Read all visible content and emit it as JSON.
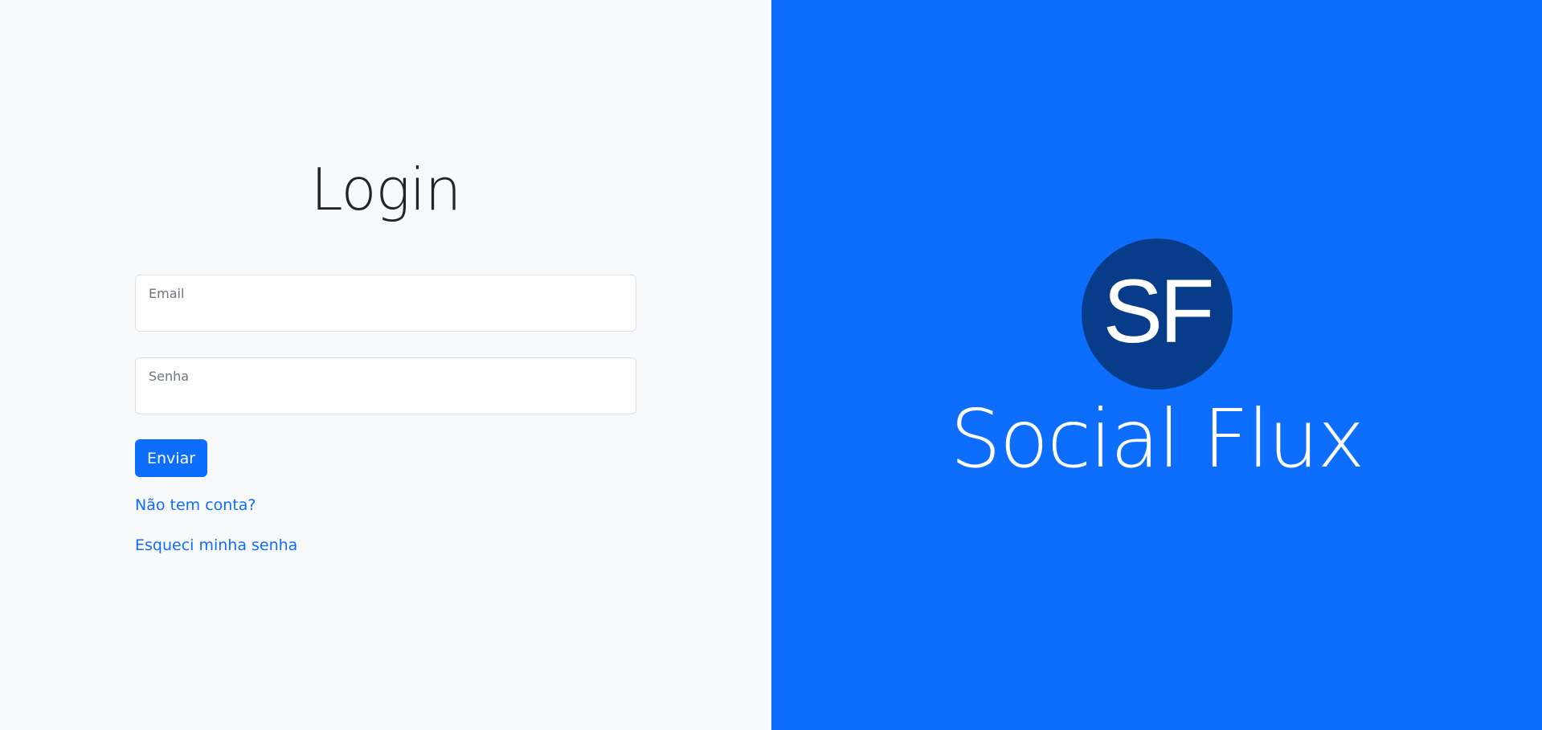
{
  "login": {
    "title": "Login",
    "email_label": "Email",
    "email_value": "",
    "password_label": "Senha",
    "password_value": "",
    "submit_label": "Enviar",
    "signup_link": "Não tem conta?",
    "forgot_link": "Esqueci minha senha"
  },
  "brand": {
    "logo_text": "SF",
    "name": "Social Flux"
  },
  "colors": {
    "primary": "#0d6efd",
    "left_background": "#f8f9fa",
    "logo_circle": "#063c8a",
    "title_text": "#212529"
  }
}
